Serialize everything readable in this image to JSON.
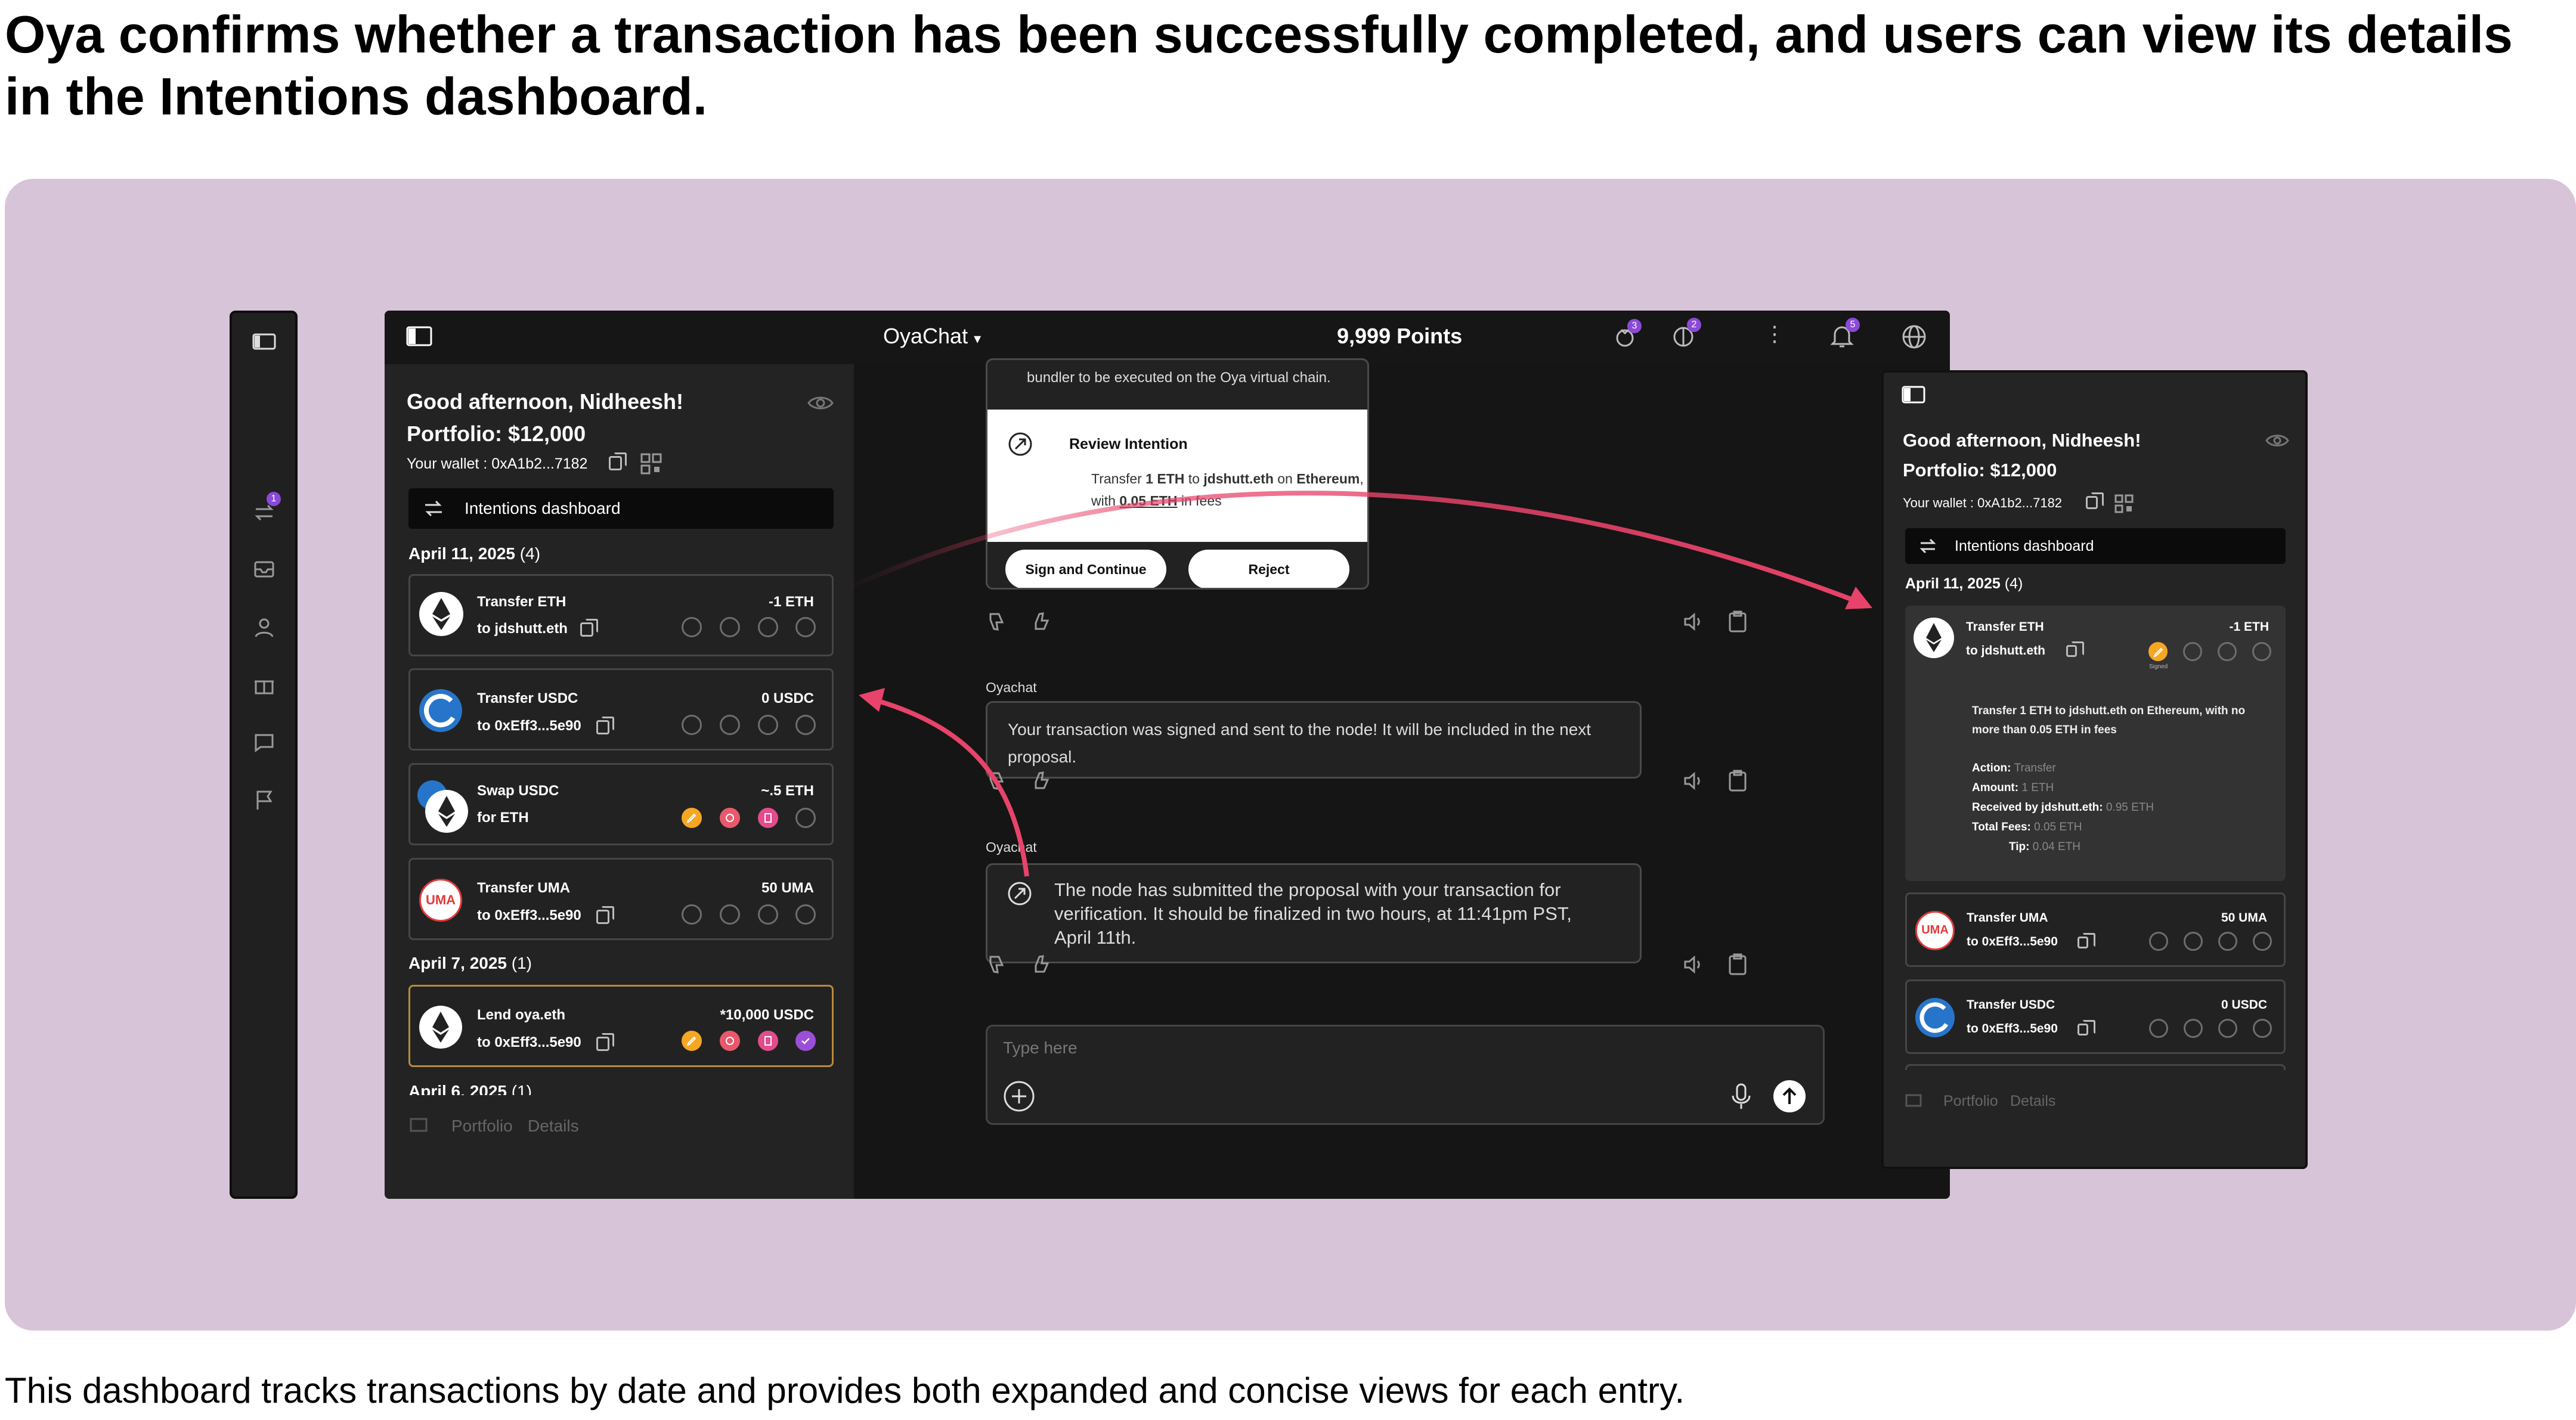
{
  "heading": "Oya confirms whether a transaction has been successfully completed, and users can view its details in the Intentions dashboard.",
  "caption": "This dashboard tracks transactions by date and provides both expanded and concise views for each entry.",
  "colors": {
    "canvas": "#d8c4d9",
    "accent": "#8b49d8",
    "arrow": "#e8436a",
    "pending": "#f5a623"
  },
  "rail": {
    "badge": "1",
    "icons": [
      "panel-toggle-icon",
      "swap-icon",
      "inbox-icon",
      "user-icon",
      "gift-icon",
      "chat-icon",
      "flag-icon"
    ]
  },
  "topbar": {
    "app_name": "OyaChat",
    "points": "9,999 Points",
    "badge_a": "3",
    "badge_b": "2",
    "badge_notifications": "5"
  },
  "sidebar": {
    "greeting": "Good afternoon, Nidheesh!",
    "portfolio": "Portfolio: $12,000",
    "wallet": "Your wallet : 0xA1b2...7182",
    "dashboard_label": "Intentions dashboard",
    "groups": [
      {
        "date": "April 11, 2025",
        "count": "(4)"
      },
      {
        "date": "April 7, 2025",
        "count": "(1)"
      },
      {
        "date": "April 6, 2025",
        "count": "(1)"
      }
    ],
    "transactions": [
      {
        "title": "Transfer ETH",
        "amount": "-1 ETH",
        "sub": "to  jdshutt.eth",
        "coin": "ethereum-icon"
      },
      {
        "title": "Transfer USDC",
        "amount": "0 USDC",
        "sub": "to 0xEff3...5e90",
        "coin": "usdc-icon"
      },
      {
        "title": "Swap USDC",
        "amount": "~.5 ETH",
        "sub": "for ETH",
        "coin": "swap-coins-icon"
      },
      {
        "title": "Transfer UMA",
        "amount": "50 UMA",
        "sub": "to 0xEff3...5e90",
        "coin": "uma-icon"
      },
      {
        "title": "Lend oya.eth",
        "amount": "*10,000 USDC",
        "sub": "to 0xEff3...5e90",
        "coin": "ethereum-icon"
      }
    ],
    "footer_tabs": [
      "Portfolio",
      "Details"
    ]
  },
  "chat": {
    "partial_text": "bundler to be executed on the Oya virtual chain.",
    "review": {
      "title": "Review Intention",
      "line1": [
        "Transfer ",
        "1 ETH",
        " to ",
        "jdshutt.eth",
        " on ",
        "Ethereum",
        ","
      ],
      "line2": [
        "with ",
        "0.05 ETH",
        " in fees"
      ],
      "sign": "Sign and Continue",
      "reject": "Reject"
    },
    "sender1": "Oyachat",
    "msg1": "Your transaction was signed and sent to the node! It will be included in the next proposal.",
    "sender2": "Oyachat",
    "msg2": "The node has submitted the proposal with your transaction for verification. It should be finalized in two hours, at 11:41pm PST, April 11th.",
    "input_placeholder": "Type here"
  },
  "right_panel": {
    "greeting": "Good afternoon, Nidheesh!",
    "portfolio": "Portfolio: $12,000",
    "wallet": "Your wallet : 0xA1b2...7182",
    "dashboard_label": "Intentions dashboard",
    "date": "April 11, 2025",
    "count": "(4)",
    "expanded": {
      "title": "Transfer ETH",
      "amount": "-1 ETH",
      "sub": "to  jdshutt.eth",
      "status": "Signed",
      "summary": "Transfer 1 ETH to jdshutt.eth on Ethereum, with no more than 0.05 ETH in fees",
      "details": [
        {
          "label": "Action:",
          "value": "Transfer"
        },
        {
          "label": "Amount:",
          "value": "1 ETH"
        },
        {
          "label": "Received by jdshutt.eth:",
          "value": "0.95 ETH"
        },
        {
          "label": "Total Fees:",
          "value": "0.05 ETH"
        },
        {
          "label": "Tip:",
          "value": "0.04 ETH"
        }
      ]
    },
    "items": [
      {
        "title": "Transfer UMA",
        "amount": "50 UMA",
        "sub": "to 0xEff3...5e90"
      },
      {
        "title": "Transfer USDC",
        "amount": "0 USDC",
        "sub": "to 0xEff3...5e90"
      }
    ],
    "footer_tabs": [
      "Portfolio",
      "Details"
    ]
  }
}
